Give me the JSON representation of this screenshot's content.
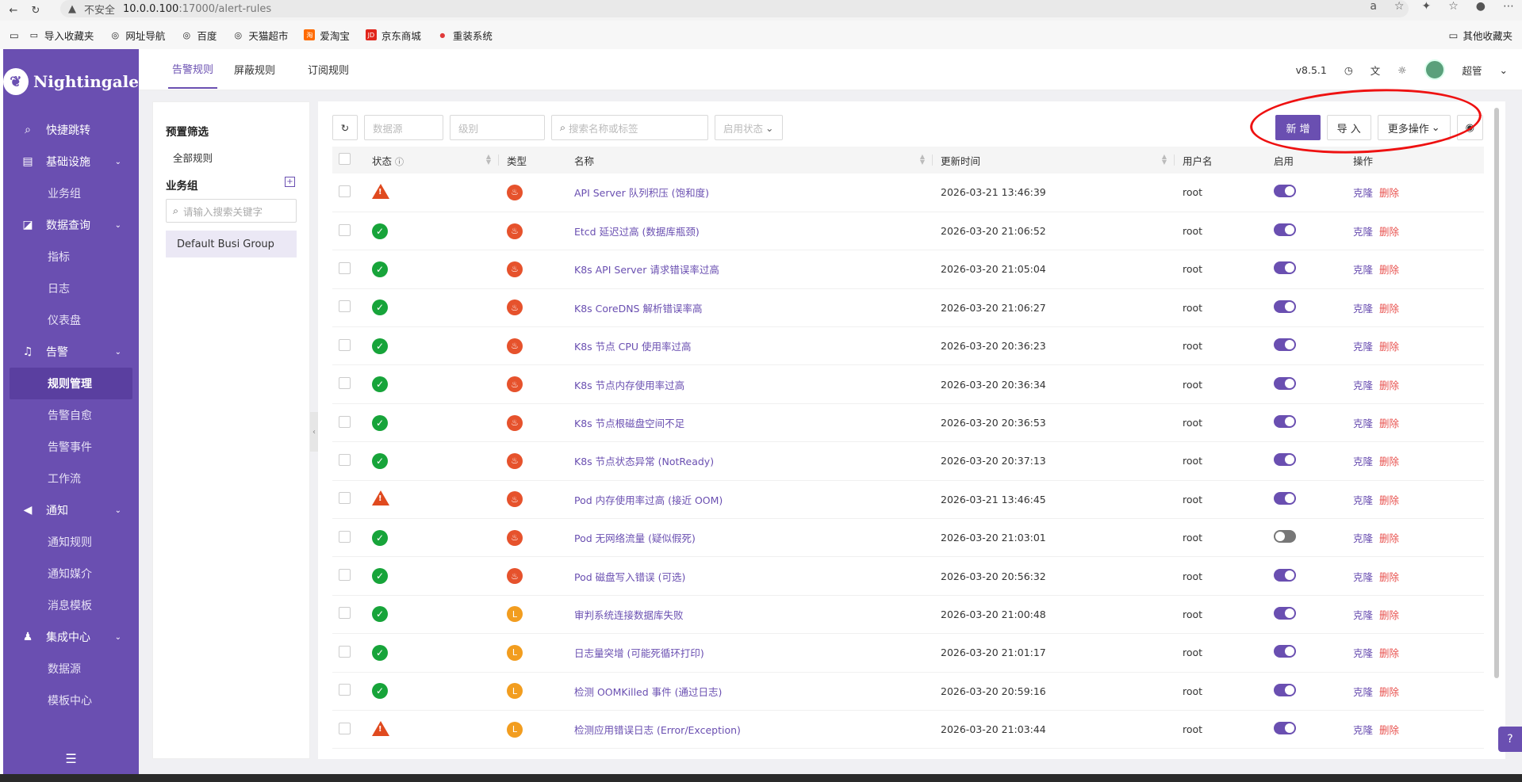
{
  "browser": {
    "insecure_label": "不安全",
    "host": "10.0.0.100",
    "path": ":17000/alert-rules",
    "bookmarks": [
      {
        "label": "导入收藏夹",
        "icon": "folder-icon"
      },
      {
        "label": "网址导航",
        "icon": "globe-icon"
      },
      {
        "label": "百度",
        "icon": "globe-icon"
      },
      {
        "label": "天猫超市",
        "icon": "globe-icon"
      },
      {
        "label": "爱淘宝",
        "icon": "taobao-icon"
      },
      {
        "label": "京东商城",
        "icon": "jd-icon"
      },
      {
        "label": "重装系统",
        "icon": "tomato-icon"
      }
    ],
    "other_bookmarks": "其他收藏夹"
  },
  "sidebar": {
    "brand": "Nightingale",
    "items": [
      {
        "label": "快捷跳转",
        "icon": "search-icon"
      },
      {
        "label": "基础设施",
        "icon": "server-icon",
        "children": [
          "业务组"
        ]
      },
      {
        "label": "数据查询",
        "icon": "chart-icon",
        "children": [
          "指标",
          "日志",
          "仪表盘"
        ]
      },
      {
        "label": "告警",
        "icon": "bell-icon",
        "children": [
          "规则管理",
          "告警自愈",
          "告警事件",
          "工作流"
        ]
      },
      {
        "label": "通知",
        "icon": "megaphone-icon",
        "children": [
          "通知规则",
          "通知媒介",
          "消息模板"
        ]
      },
      {
        "label": "集成中心",
        "icon": "integration-icon",
        "children": [
          "数据源",
          "模板中心"
        ]
      }
    ],
    "active_child": "规则管理"
  },
  "topbar": {
    "tabs": [
      "告警规则",
      "屏蔽规则",
      "订阅规则"
    ],
    "active_tab": "告警规则",
    "version": "v8.5.1",
    "user": "超管"
  },
  "left_panel": {
    "preset_title": "预置筛选",
    "all_rules": "全部规则",
    "group_title": "业务组",
    "search_placeholder": "请输入搜索关键字",
    "group_item": "Default Busi Group"
  },
  "toolbar": {
    "datasource_placeholder": "数据源",
    "level_placeholder": "级别",
    "search_placeholder": "搜索名称或标签",
    "enable_status_placeholder": "启用状态",
    "new_label": "新 增",
    "import_label": "导 入",
    "more_label": "更多操作"
  },
  "table": {
    "columns": [
      "状态",
      "类型",
      "名称",
      "更新时间",
      "用户名",
      "启用",
      "操作"
    ],
    "clone_label": "克隆",
    "delete_label": "删除",
    "rows": [
      {
        "status": "warn",
        "type": "prometheus",
        "name": "API Server 队列积压 (饱和度)",
        "updated": "2026-03-21 13:46:39",
        "user": "root",
        "enabled": true
      },
      {
        "status": "ok",
        "type": "prometheus",
        "name": "Etcd 延迟过高 (数据库瓶颈)",
        "updated": "2026-03-20 21:06:52",
        "user": "root",
        "enabled": true
      },
      {
        "status": "ok",
        "type": "prometheus",
        "name": "K8s API Server 请求错误率过高",
        "updated": "2026-03-20 21:05:04",
        "user": "root",
        "enabled": true
      },
      {
        "status": "ok",
        "type": "prometheus",
        "name": "K8s CoreDNS 解析错误率高",
        "updated": "2026-03-20 21:06:27",
        "user": "root",
        "enabled": true
      },
      {
        "status": "ok",
        "type": "prometheus",
        "name": "K8s 节点 CPU 使用率过高",
        "updated": "2026-03-20 20:36:23",
        "user": "root",
        "enabled": true
      },
      {
        "status": "ok",
        "type": "prometheus",
        "name": "K8s 节点内存使用率过高",
        "updated": "2026-03-20 20:36:34",
        "user": "root",
        "enabled": true
      },
      {
        "status": "ok",
        "type": "prometheus",
        "name": "K8s 节点根磁盘空间不足",
        "updated": "2026-03-20 20:36:53",
        "user": "root",
        "enabled": true
      },
      {
        "status": "ok",
        "type": "prometheus",
        "name": "K8s 节点状态异常 (NotReady)",
        "updated": "2026-03-20 20:37:13",
        "user": "root",
        "enabled": true
      },
      {
        "status": "warn",
        "type": "prometheus",
        "name": "Pod 内存使用率过高 (接近 OOM)",
        "updated": "2026-03-21 13:46:45",
        "user": "root",
        "enabled": true
      },
      {
        "status": "ok",
        "type": "prometheus",
        "name": "Pod 无网络流量 (疑似假死)",
        "updated": "2026-03-20 21:03:01",
        "user": "root",
        "enabled": false
      },
      {
        "status": "ok",
        "type": "prometheus",
        "name": "Pod 磁盘写入错误 (可选)",
        "updated": "2026-03-20 20:56:32",
        "user": "root",
        "enabled": true
      },
      {
        "status": "ok",
        "type": "loki",
        "name": "审判系统连接数据库失败",
        "updated": "2026-03-20 21:00:48",
        "user": "root",
        "enabled": true
      },
      {
        "status": "ok",
        "type": "loki",
        "name": "日志量突增 (可能死循环打印)",
        "updated": "2026-03-20 21:01:17",
        "user": "root",
        "enabled": true
      },
      {
        "status": "ok",
        "type": "loki",
        "name": "检测 OOMKilled 事件 (通过日志)",
        "updated": "2026-03-20 20:59:16",
        "user": "root",
        "enabled": true
      },
      {
        "status": "warn",
        "type": "loki",
        "name": "检测应用错误日志 (Error/Exception)",
        "updated": "2026-03-20 21:03:44",
        "user": "root",
        "enabled": true
      }
    ]
  },
  "colors": {
    "brand": "#6a4fb1",
    "ok": "#17a43a",
    "warn": "#e04a1f",
    "prometheus": "#e6522c",
    "loki": "#f29d1f",
    "delete": "#e8514e"
  }
}
